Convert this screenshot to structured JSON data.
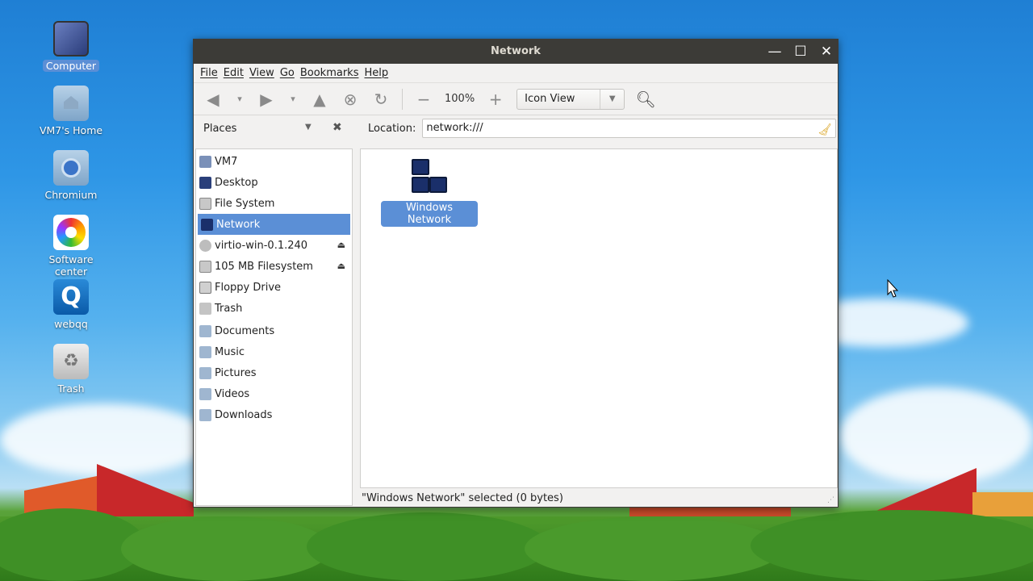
{
  "desktop": {
    "icons": [
      {
        "label": "Computer",
        "icon": "computer-icon",
        "selected": true
      },
      {
        "label": "VM7's Home",
        "icon": "home-folder-icon",
        "selected": false
      },
      {
        "label": "Chromium",
        "icon": "chromium-icon",
        "selected": false
      },
      {
        "label": "Software center",
        "icon": "software-center-icon",
        "selected": false
      },
      {
        "label": "webqq",
        "icon": "webqq-icon",
        "selected": false
      },
      {
        "label": "Trash",
        "icon": "trash-icon",
        "selected": false
      }
    ]
  },
  "window": {
    "title": "Network",
    "controls": {
      "minimize": "—",
      "maximize": "☐",
      "close": "✕"
    }
  },
  "menu": [
    "File",
    "Edit",
    "View",
    "Go",
    "Bookmarks",
    "Help"
  ],
  "toolbar": {
    "zoom": "100%",
    "view_mode": "Icon View"
  },
  "places": {
    "header": "Places",
    "items": [
      {
        "label": "VM7",
        "icon": "computer-icon"
      },
      {
        "label": "Desktop",
        "icon": "desktop-icon"
      },
      {
        "label": "File System",
        "icon": "drive-icon"
      },
      {
        "label": "Network",
        "icon": "network-icon",
        "active": true
      },
      {
        "label": "virtio-win-0.1.240",
        "icon": "cdrom-icon",
        "eject": true
      },
      {
        "label": "105 MB Filesystem",
        "icon": "drive-icon",
        "eject": true
      },
      {
        "label": "Floppy Drive",
        "icon": "floppy-icon"
      },
      {
        "label": "Trash",
        "icon": "trash-icon"
      },
      {
        "label": "Documents",
        "icon": "folder-icon"
      },
      {
        "label": "Music",
        "icon": "folder-icon"
      },
      {
        "label": "Pictures",
        "icon": "folder-icon"
      },
      {
        "label": "Videos",
        "icon": "folder-icon"
      },
      {
        "label": "Downloads",
        "icon": "folder-icon"
      }
    ]
  },
  "location": {
    "label": "Location:",
    "value": "network:///"
  },
  "content": {
    "items": [
      {
        "label": "Windows Network",
        "icon": "windows-network-icon",
        "selected": true
      }
    ]
  },
  "status": "\"Windows Network\" selected (0 bytes)",
  "colors": {
    "selection": "#5b8fd6",
    "titlebar": "#3c3b37"
  }
}
